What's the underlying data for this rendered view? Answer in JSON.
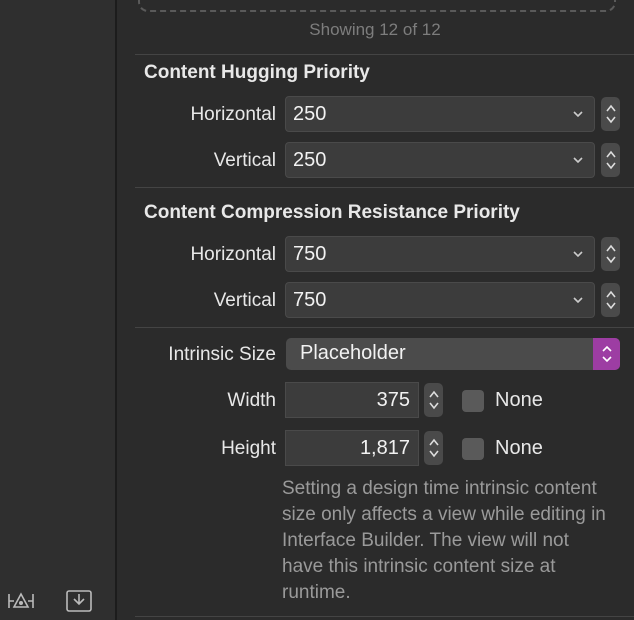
{
  "footer": {
    "showing_text": "Showing 12 of 12"
  },
  "content_hugging": {
    "title": "Content Hugging Priority",
    "horizontal_label": "Horizontal",
    "horizontal_value": "250",
    "vertical_label": "Vertical",
    "vertical_value": "250"
  },
  "compression_resistance": {
    "title": "Content Compression Resistance Priority",
    "horizontal_label": "Horizontal",
    "horizontal_value": "750",
    "vertical_label": "Vertical",
    "vertical_value": "750"
  },
  "intrinsic_size": {
    "label": "Intrinsic Size",
    "value": "Placeholder",
    "width_label": "Width",
    "width_value": "375",
    "height_label": "Height",
    "height_value": "1,817",
    "none_label": "None",
    "help_text": "Setting a design time intrinsic content size only affects a view while editing in Interface Builder. The view will not have this intrinsic content size at runtime."
  },
  "colors": {
    "accent": "#9d3da3",
    "background": "#2b2b2b"
  },
  "icons": [
    "resolve-constraints-icon",
    "embed-in-icon",
    "chevron-down-icon",
    "stepper-icon",
    "popup-arrows-icon"
  ]
}
